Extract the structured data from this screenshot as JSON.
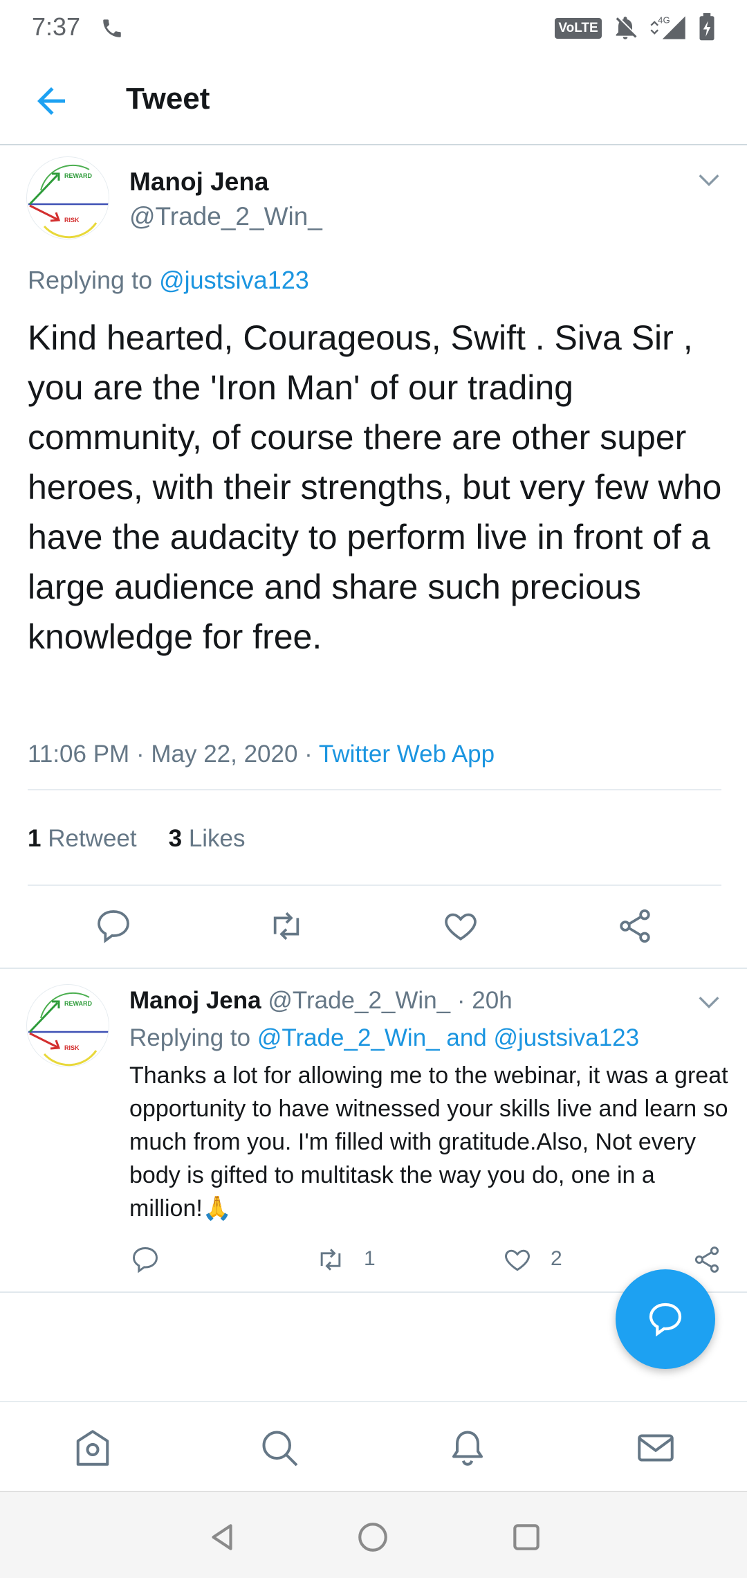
{
  "status_bar": {
    "time": "7:37",
    "volte_label": "VoLTE",
    "network_label": "4G"
  },
  "header": {
    "title": "Tweet"
  },
  "main_tweet": {
    "name": "Manoj Jena",
    "handle": "@Trade_2_Win_",
    "replying_prefix": "Replying to ",
    "replying_to": "@justsiva123",
    "text": "Kind hearted, Courageous, Swift . Siva Sir , you are the 'Iron Man' of our trading community, of course there are other super heroes, with their strengths, but very few who have the audacity to perform live in front of a large audience and share such precious knowledge for free.",
    "time": "11:06 PM",
    "date": "May 22, 2020",
    "separator": "·",
    "source": "Twitter Web App",
    "retweet_count": "1",
    "retweet_label": "Retweet",
    "likes_count": "3",
    "likes_label": "Likes",
    "avatar_labels": {
      "reward": "REWARD",
      "risk": "RISK"
    }
  },
  "reply_tweet": {
    "name": "Manoj Jena",
    "handle": "@Trade_2_Win_",
    "time_ago": "· 20h",
    "replying_prefix": "Replying to ",
    "replying_to": "@Trade_2_Win_ and @justsiva123",
    "text": "Thanks a lot for allowing me to the webinar, it was a great opportunity to have witnessed your skills live and learn so much from you. I'm filled with gratitude.Also, Not every body is gifted to multitask the way you do, one in a million!🙏",
    "retweet_count": "1",
    "like_count": "2"
  },
  "icons": {
    "back": "arrow-left-icon",
    "chevron": "chevron-down-icon",
    "reply": "reply-icon",
    "retweet": "retweet-icon",
    "like": "heart-icon",
    "share": "share-icon",
    "compose_reply": "compose-reply-icon",
    "home": "home-icon",
    "search": "search-icon",
    "notifications": "bell-icon",
    "messages": "mail-icon"
  },
  "colors": {
    "accent": "#1da1f2",
    "link": "#1b95e0",
    "secondary_text": "#657786",
    "primary_text": "#14171a"
  }
}
